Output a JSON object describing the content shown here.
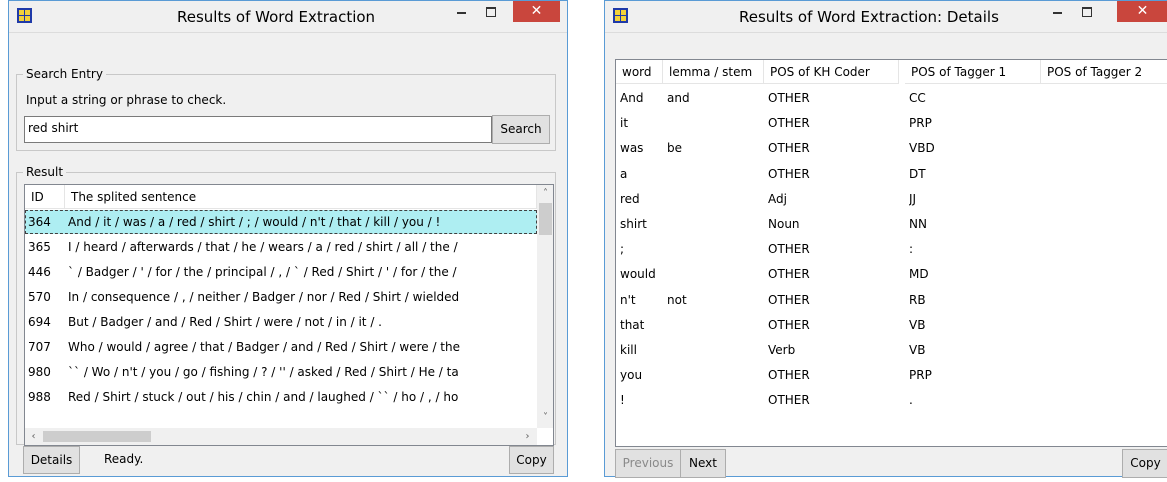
{
  "main_window": {
    "title": "Results of Word Extraction",
    "search_group": {
      "legend": "Search Entry",
      "instruction": "Input a string or phrase to check.",
      "input_value": "red shirt",
      "search_button": "Search"
    },
    "result_group": {
      "legend": "Result",
      "columns": [
        "ID",
        "The splited sentence"
      ],
      "rows": [
        {
          "id": "364",
          "text": "And / it / was / a / red / shirt / ; / would / n't / that / kill / you / !"
        },
        {
          "id": "365",
          "text": "I / heard / afterwards / that / he / wears / a / red / shirt / all / the /"
        },
        {
          "id": "446",
          "text": "` / Badger / ' / for / the / principal / , / ` / Red / Shirt / ' / for / the /"
        },
        {
          "id": "570",
          "text": "In / consequence / , / neither / Badger / nor / Red / Shirt / wielded"
        },
        {
          "id": "694",
          "text": "But / Badger / and / Red / Shirt / were / not / in / it / ."
        },
        {
          "id": "707",
          "text": "Who / would / agree / that / Badger / and / Red / Shirt / were / the"
        },
        {
          "id": "980",
          "text": "`` / Wo / n't / you / go / fishing / ? / '' / asked / Red / Shirt / He / ta"
        },
        {
          "id": "988",
          "text": "Red / Shirt / stuck / out / his / chin / and / laughed / `` / ho / , / ho"
        }
      ]
    },
    "details_button": "Details",
    "status": "Ready.",
    "copy_button": "Copy"
  },
  "details_window": {
    "title": "Results of Word Extraction: Details",
    "columns": [
      "word",
      "lemma / stem",
      "POS of KH Coder",
      "POS of Tagger 1",
      "POS of Tagger 2"
    ],
    "rows": [
      {
        "word": "And",
        "lemma": "and",
        "kh": "OTHER",
        "t1": "CC",
        "t2": ""
      },
      {
        "word": "it",
        "lemma": "",
        "kh": "OTHER",
        "t1": "PRP",
        "t2": ""
      },
      {
        "word": "was",
        "lemma": "be",
        "kh": "OTHER",
        "t1": "VBD",
        "t2": ""
      },
      {
        "word": "a",
        "lemma": "",
        "kh": "OTHER",
        "t1": "DT",
        "t2": ""
      },
      {
        "word": "red",
        "lemma": "",
        "kh": "Adj",
        "t1": "JJ",
        "t2": ""
      },
      {
        "word": "shirt",
        "lemma": "",
        "kh": "Noun",
        "t1": "NN",
        "t2": ""
      },
      {
        "word": ";",
        "lemma": "",
        "kh": "OTHER",
        "t1": ":",
        "t2": ""
      },
      {
        "word": "would",
        "lemma": "",
        "kh": "OTHER",
        "t1": "MD",
        "t2": ""
      },
      {
        "word": "n't",
        "lemma": "not",
        "kh": "OTHER",
        "t1": "RB",
        "t2": ""
      },
      {
        "word": "that",
        "lemma": "",
        "kh": "OTHER",
        "t1": "VB",
        "t2": ""
      },
      {
        "word": "kill",
        "lemma": "",
        "kh": "Verb",
        "t1": "VB",
        "t2": ""
      },
      {
        "word": "you",
        "lemma": "",
        "kh": "OTHER",
        "t1": "PRP",
        "t2": ""
      },
      {
        "word": "!",
        "lemma": "",
        "kh": "OTHER",
        "t1": ".",
        "t2": ""
      }
    ],
    "previous_button": "Previous",
    "next_button": "Next",
    "copy_button": "Copy"
  },
  "icons": {
    "app": "app-grid-icon",
    "minimize": "minimize-icon",
    "maximize": "maximize-icon",
    "close": "close-icon",
    "scroll_up": "chevron-up-icon",
    "scroll_down": "chevron-down-icon",
    "scroll_left": "chevron-left-icon",
    "scroll_right": "chevron-right-icon"
  },
  "colors": {
    "selected_row": "#aeeef2",
    "close_button": "#c9463d",
    "window_border": "#5a9bd5"
  }
}
